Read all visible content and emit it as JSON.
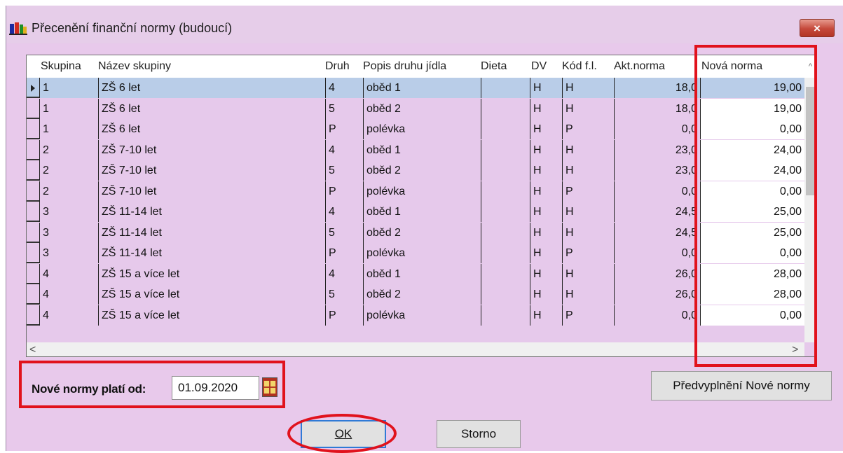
{
  "window": {
    "title": "Přecenění finanční normy (budoucí)",
    "close_label": "×"
  },
  "table": {
    "columns": [
      "Skupina",
      "Název skupiny",
      "Druh",
      "Popis druhu jídla",
      "Dieta",
      "DV",
      "Kód f.l.",
      "Akt.norma",
      "Nová norma"
    ],
    "rows": [
      {
        "skupina": "1",
        "nazev": "ZŠ 6 let",
        "druh": "4",
        "popis": "oběd 1",
        "dieta": "",
        "dv": "H",
        "kod": "H",
        "akt": "18,0",
        "nova": "19,00"
      },
      {
        "skupina": "1",
        "nazev": "ZŠ 6 let",
        "druh": "5",
        "popis": "oběd 2",
        "dieta": "",
        "dv": "H",
        "kod": "H",
        "akt": "18,0",
        "nova": "19,00"
      },
      {
        "skupina": "1",
        "nazev": "ZŠ 6 let",
        "druh": "P",
        "popis": "polévka",
        "dieta": "",
        "dv": "H",
        "kod": "P",
        "akt": "0,0",
        "nova": "0,00"
      },
      {
        "skupina": "2",
        "nazev": "ZŠ 7-10 let",
        "druh": "4",
        "popis": "oběd 1",
        "dieta": "",
        "dv": "H",
        "kod": "H",
        "akt": "23,0",
        "nova": "24,00"
      },
      {
        "skupina": "2",
        "nazev": "ZŠ 7-10 let",
        "druh": "5",
        "popis": "oběd 2",
        "dieta": "",
        "dv": "H",
        "kod": "H",
        "akt": "23,0",
        "nova": "24,00"
      },
      {
        "skupina": "2",
        "nazev": "ZŠ 7-10 let",
        "druh": "P",
        "popis": "polévka",
        "dieta": "",
        "dv": "H",
        "kod": "P",
        "akt": "0,0",
        "nova": "0,00"
      },
      {
        "skupina": "3",
        "nazev": "ZŠ 11-14 let",
        "druh": "4",
        "popis": "oběd 1",
        "dieta": "",
        "dv": "H",
        "kod": "H",
        "akt": "24,5",
        "nova": "25,00"
      },
      {
        "skupina": "3",
        "nazev": "ZŠ 11-14 let",
        "druh": "5",
        "popis": "oběd 2",
        "dieta": "",
        "dv": "H",
        "kod": "H",
        "akt": "24,5",
        "nova": "25,00"
      },
      {
        "skupina": "3",
        "nazev": "ZŠ 11-14 let",
        "druh": "P",
        "popis": "polévka",
        "dieta": "",
        "dv": "H",
        "kod": "P",
        "akt": "0,0",
        "nova": "0,00"
      },
      {
        "skupina": "4",
        "nazev": "ZŠ 15 a více let",
        "druh": "4",
        "popis": "oběd 1",
        "dieta": "",
        "dv": "H",
        "kod": "H",
        "akt": "26,0",
        "nova": "28,00"
      },
      {
        "skupina": "4",
        "nazev": "ZŠ 15 a více let",
        "druh": "5",
        "popis": "oběd 2",
        "dieta": "",
        "dv": "H",
        "kod": "H",
        "akt": "26,0",
        "nova": "28,00"
      },
      {
        "skupina": "4",
        "nazev": "ZŠ 15 a více let",
        "druh": "P",
        "popis": "polévka",
        "dieta": "",
        "dv": "H",
        "kod": "P",
        "akt": "0,0",
        "nova": "0,00"
      }
    ],
    "selected_row": 0
  },
  "scroll": {
    "left_arrow": "<",
    "right_arrow": ">",
    "up_arrow": "^"
  },
  "date": {
    "label": "Nové normy platí od:",
    "value": "01.09.2020"
  },
  "buttons": {
    "prefill": "Předvyplnění Nové normy",
    "ok": "OK",
    "storno": "Storno"
  },
  "colors": {
    "window_bg": "#e8c9eb",
    "selected_row": "#b9cde8",
    "highlight": "#e1121c",
    "focus_border": "#2f7ad6"
  },
  "icons": {
    "app": "app-icon",
    "close": "close-icon",
    "calendar": "calendar-icon"
  }
}
